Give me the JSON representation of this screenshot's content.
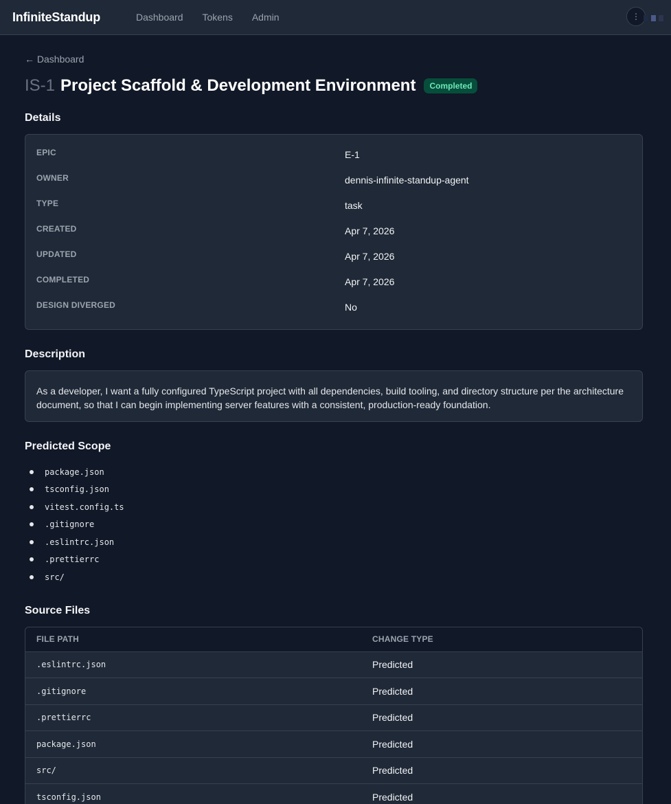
{
  "nav": {
    "brand": "InfiniteStandup",
    "links": [
      "Dashboard",
      "Tokens",
      "Admin"
    ],
    "menu_glyph": "⋮"
  },
  "page": {
    "back_link": "← Dashboard",
    "key": "IS-1",
    "title": "Project Scaffold & Development Environment",
    "status": "Completed"
  },
  "details": {
    "heading": "Details",
    "rows": [
      {
        "label": "EPIC",
        "value": "E-1"
      },
      {
        "label": "OWNER",
        "value": "dennis-infinite-standup-agent"
      },
      {
        "label": "TYPE",
        "value": "task"
      },
      {
        "label": "CREATED",
        "value": "Apr 7, 2026"
      },
      {
        "label": "UPDATED",
        "value": "Apr 7, 2026"
      },
      {
        "label": "COMPLETED",
        "value": "Apr 7, 2026"
      },
      {
        "label": "DESIGN DIVERGED",
        "value": "No"
      }
    ]
  },
  "description": {
    "heading": "Description",
    "text": "As a developer, I want a fully configured TypeScript project with all dependencies, build tooling, and directory structure per the architecture document, so that I can begin implementing server features with a consistent, production-ready foundation."
  },
  "scope": {
    "heading": "Predicted Scope",
    "items": [
      "package.json",
      "tsconfig.json",
      "vitest.config.ts",
      ".gitignore",
      ".eslintrc.json",
      ".prettierrc",
      "src/"
    ]
  },
  "source_files": {
    "heading": "Source Files",
    "columns": [
      "FILE PATH",
      "CHANGE TYPE"
    ],
    "rows": [
      {
        "path": ".eslintrc.json",
        "change": "Predicted"
      },
      {
        "path": ".gitignore",
        "change": "Predicted"
      },
      {
        "path": ".prettierrc",
        "change": "Predicted"
      },
      {
        "path": "package.json",
        "change": "Predicted"
      },
      {
        "path": "src/",
        "change": "Predicted"
      },
      {
        "path": "tsconfig.json",
        "change": "Predicted"
      }
    ]
  },
  "colors": {
    "background": "#111827",
    "surface": "#1f2937",
    "border": "#374151",
    "badge_bg": "#064e3b",
    "badge_fg": "#6ee7b7"
  }
}
